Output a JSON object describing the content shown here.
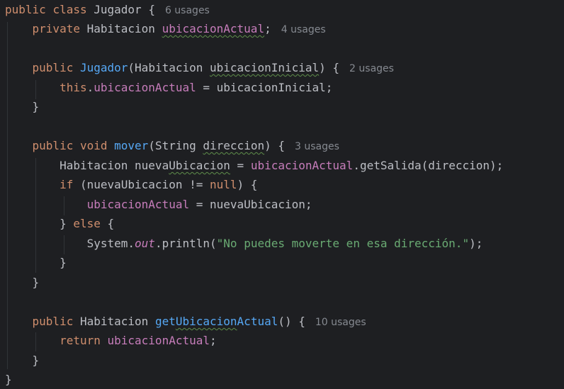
{
  "editor": {
    "language": "java",
    "class_name": "Jugador",
    "usages": {
      "class": "6 usages",
      "field": "4 usages",
      "constructor": "2 usages",
      "mover": "3 usages",
      "getter": "10 usages"
    },
    "tokens": {
      "public": "public",
      "class": "class",
      "private": "private",
      "this": "this",
      "void": "void",
      "if": "if",
      "null": "null",
      "else": "else",
      "return": "return",
      "habitacion": "Habitacion",
      "string": "String",
      "system": "System",
      "out": "out",
      "println": "println",
      "field_ubicacion_actual": "ubicacionActual",
      "param_ubicacion_inicial": "ubicacionInicial",
      "param_direccion": "direccion",
      "method_mover": "mover",
      "method_get_salida": "getSalida",
      "method_get_ubicacion_actual": "getUbicacionActual",
      "var_nueva_ubicacion": "nuevaUbicacion",
      "nueva_prefix": "nueva",
      "ubicacion_part": "Ubicacion",
      "get_prefix": "get",
      "actual_suffix": "Actual",
      "message_string": "\"No puedes moverte en esa dirección.\""
    },
    "colors": {
      "background": "#1e1f22",
      "keyword": "#cf8e6d",
      "field": "#c77dbb",
      "method": "#56a8f5",
      "string": "#6aab73",
      "default_text": "#bcbec4",
      "inlay_hint": "#868a91"
    }
  }
}
